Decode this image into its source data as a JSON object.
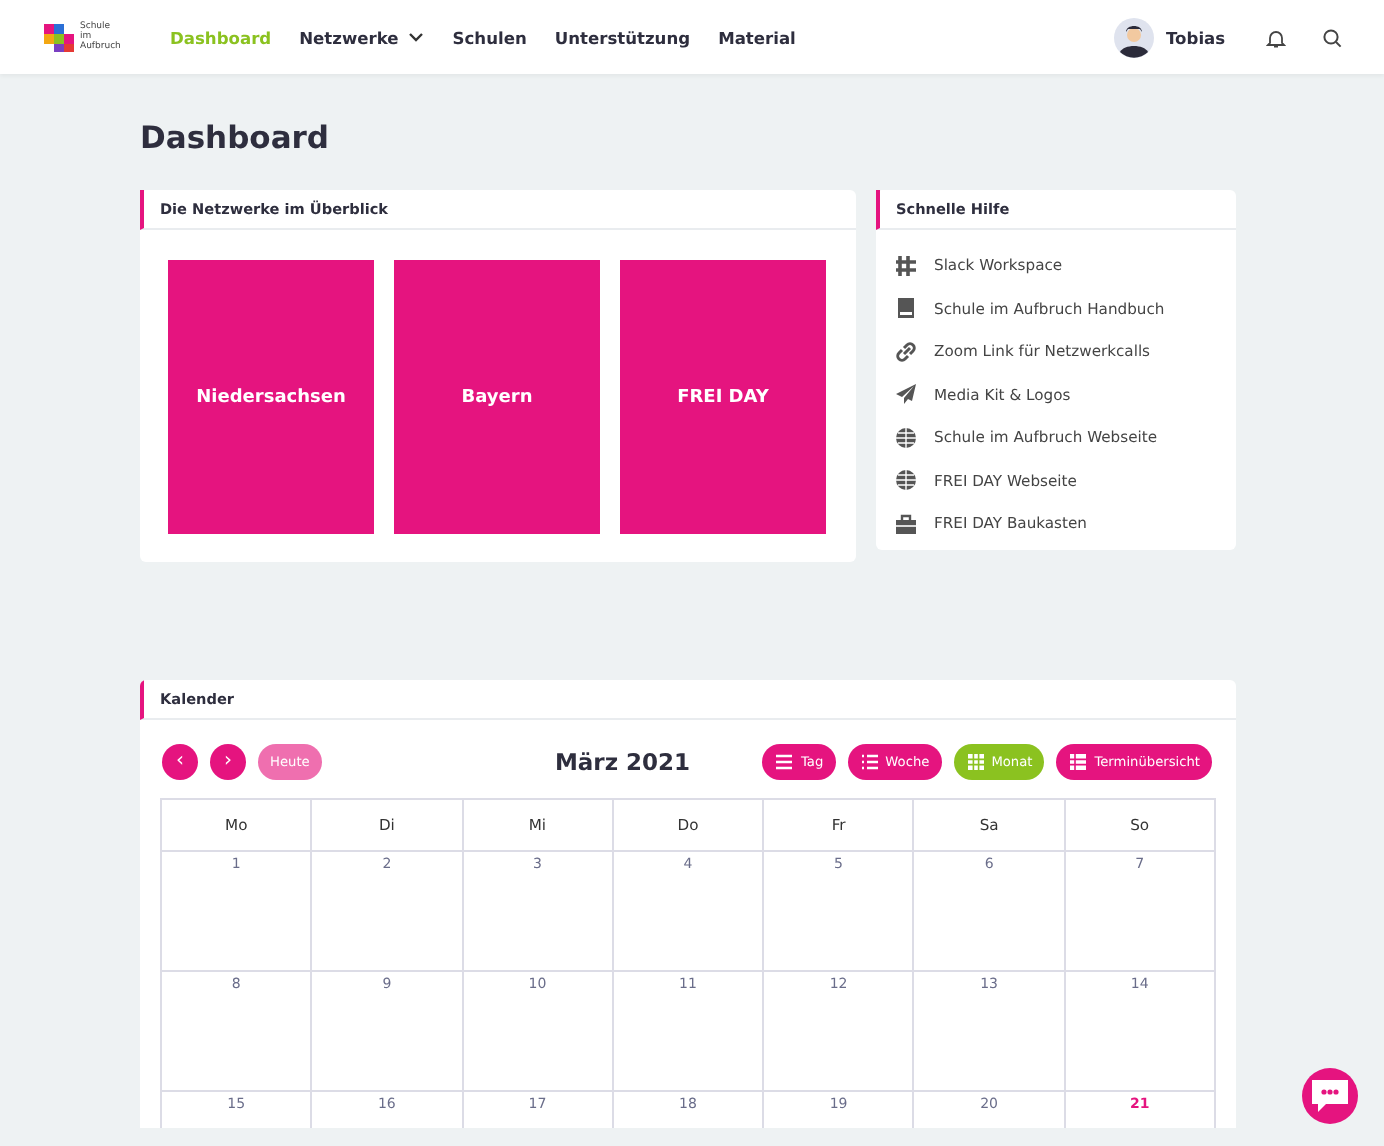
{
  "header": {
    "logo_text": "Schule im Aufbruch",
    "nav": [
      {
        "label": "Dashboard",
        "selected": true,
        "dropdown": false
      },
      {
        "label": "Netzwerke",
        "selected": false,
        "dropdown": true
      },
      {
        "label": "Schulen",
        "selected": false,
        "dropdown": false
      },
      {
        "label": "Unterstützung",
        "selected": false,
        "dropdown": false
      },
      {
        "label": "Material",
        "selected": false,
        "dropdown": false
      }
    ],
    "user": "Tobias"
  },
  "page_title": "Dashboard",
  "networks": {
    "title": "Die Netzwerke im Überblick",
    "tiles": [
      "Niedersachsen",
      "Bayern",
      "FREI DAY"
    ]
  },
  "help": {
    "title": "Schnelle Hilfe",
    "links": [
      {
        "kind": "slack",
        "label": "Slack Workspace"
      },
      {
        "kind": "book",
        "label": "Schule im Aufbruch Handbuch"
      },
      {
        "kind": "link",
        "label": "Zoom Link für Netzwerkcalls"
      },
      {
        "kind": "plane",
        "label": "Media Kit & Logos"
      },
      {
        "kind": "globe",
        "label": "Schule im Aufbruch Webseite"
      },
      {
        "kind": "globe",
        "label": "FREI DAY Webseite"
      },
      {
        "kind": "toolbox",
        "label": "FREI DAY Baukasten"
      }
    ]
  },
  "calendar": {
    "title": "Kalender",
    "prev": "‹",
    "next": "›",
    "today_button": {
      "label": "Heute",
      "disabled": true
    },
    "month": "März 2021",
    "views": [
      {
        "kind": "list",
        "label": "Tag",
        "selected": false
      },
      {
        "kind": "bullets",
        "label": "Woche",
        "selected": false
      },
      {
        "kind": "grid",
        "label": "Monat",
        "selected": true
      },
      {
        "kind": "table",
        "label": "Terminübersicht",
        "selected": false
      }
    ],
    "weekdays": [
      "Mo",
      "Di",
      "Mi",
      "Do",
      "Fr",
      "Sa",
      "So"
    ],
    "weeks": [
      [
        {
          "day": "1",
          "today": false
        },
        {
          "day": "2",
          "today": false
        },
        {
          "day": "3",
          "today": false
        },
        {
          "day": "4",
          "today": false
        },
        {
          "day": "5",
          "today": false
        },
        {
          "day": "6",
          "today": false
        },
        {
          "day": "7",
          "today": false
        }
      ],
      [
        {
          "day": "8",
          "today": false
        },
        {
          "day": "9",
          "today": false
        },
        {
          "day": "10",
          "today": false
        },
        {
          "day": "11",
          "today": false
        },
        {
          "day": "12",
          "today": false
        },
        {
          "day": "13",
          "today": false
        },
        {
          "day": "14",
          "today": false
        }
      ],
      [
        {
          "day": "15",
          "today": false
        },
        {
          "day": "16",
          "today": false
        },
        {
          "day": "17",
          "today": false
        },
        {
          "day": "18",
          "today": false
        },
        {
          "day": "19",
          "today": false
        },
        {
          "day": "20",
          "today": false
        },
        {
          "day": "21",
          "today": true
        }
      ]
    ]
  }
}
